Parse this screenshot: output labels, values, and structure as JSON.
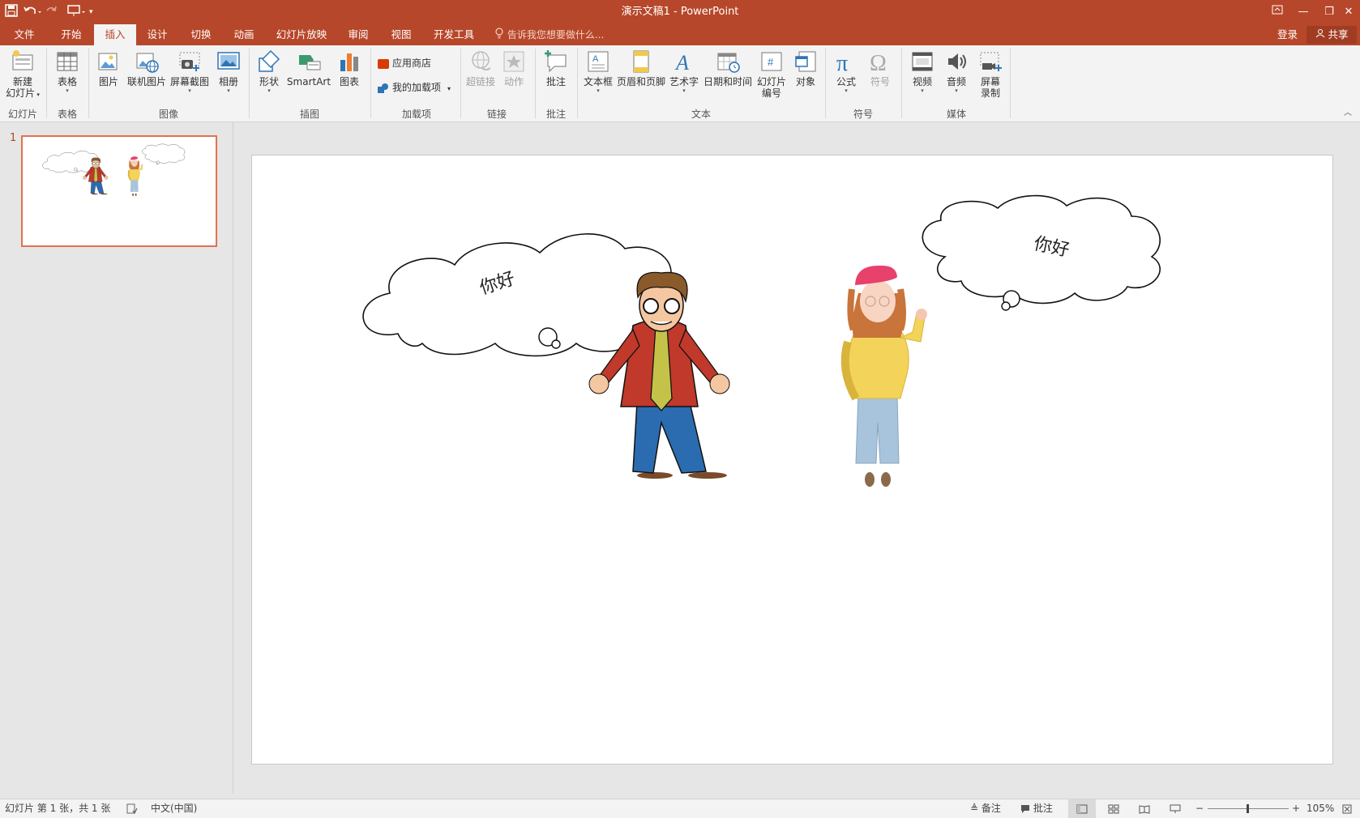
{
  "titlebar": {
    "title": "演示文稿1 - PowerPoint",
    "qat": [
      "save-icon",
      "undo-icon",
      "redo-icon",
      "present-icon",
      "customize-qat-icon"
    ]
  },
  "tabs": [
    "文件",
    "开始",
    "插入",
    "设计",
    "切换",
    "动画",
    "幻灯片放映",
    "审阅",
    "视图",
    "开发工具"
  ],
  "active_tab": "插入",
  "tellme": "告诉我您想要做什么...",
  "account": {
    "login": "登录",
    "share": "共享"
  },
  "ribbon": {
    "new_slide_l1": "新建",
    "new_slide_l2": "幻灯片",
    "table": "表格",
    "pictures": "图片",
    "online_pictures": "联机图片",
    "screenshot": "屏幕截图",
    "album": "相册",
    "shapes": "形状",
    "smartart": "SmartArt",
    "chart": "图表",
    "store": "应用商店",
    "my_addins": "我的加载项",
    "hyperlink": "超链接",
    "action": "动作",
    "comment": "批注",
    "textbox": "文本框",
    "header_footer": "页眉和页脚",
    "wordart": "艺术字",
    "datetime": "日期和时间",
    "slide_number_l1": "幻灯片",
    "slide_number_l2": "编号",
    "object": "对象",
    "equation": "公式",
    "symbol": "符号",
    "video": "视频",
    "audio": "音频",
    "screen_rec_l1": "屏幕",
    "screen_rec_l2": "录制",
    "groups": {
      "slides": "幻灯片",
      "tables": "表格",
      "images": "图像",
      "illustrations": "插图",
      "addins": "加载项",
      "links": "链接",
      "comments": "批注",
      "text": "文本",
      "symbols": "符号",
      "media": "媒体"
    }
  },
  "thumbnails": [
    {
      "number": "1"
    }
  ],
  "slide": {
    "bubble_left": "你好",
    "bubble_right": "你好"
  },
  "statusbar": {
    "slide_info": "幻灯片 第 1 张，共 1 张",
    "language": "中文(中国)",
    "notes": "备注",
    "comments": "批注",
    "zoom": "105%"
  },
  "colors": {
    "accent": "#b7472a",
    "ribbon_bg": "#f3f3f3",
    "thumb_border": "#e0724f"
  }
}
